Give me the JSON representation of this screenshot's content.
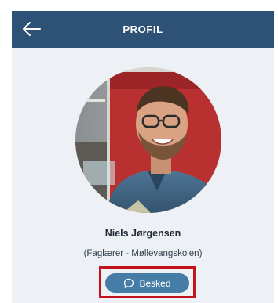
{
  "header": {
    "title": "PROFIL",
    "back_icon": "arrow-left-icon"
  },
  "profile": {
    "name": "Niels Jørgensen",
    "subtitle": "(Faglærer - Møllevangskolen)",
    "avatar_icon": "profile-photo"
  },
  "actions": {
    "message_label": "Besked",
    "message_icon": "chat-bubble-icon"
  },
  "colors": {
    "header_bg": "#2d5275",
    "page_bg": "#edf0f4",
    "button_bg": "#457da6",
    "highlight": "#c1141c"
  }
}
